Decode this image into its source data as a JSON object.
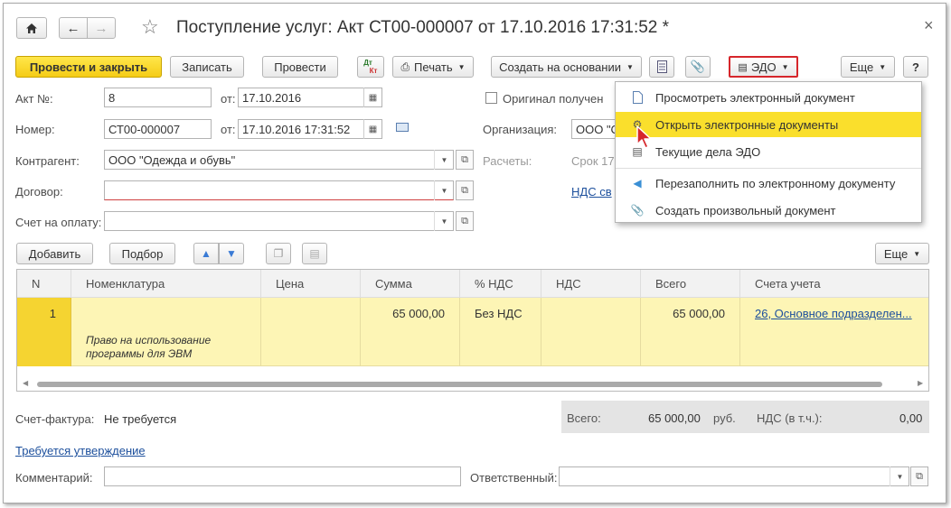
{
  "window": {
    "title": "Поступление услуг: Акт СТ00-000007 от 17.10.2016 17:31:52 *",
    "close_glyph": "×"
  },
  "toolbar": {
    "post_close": "Провести и закрыть",
    "save": "Записать",
    "post": "Провести",
    "dtkt_top": "Дт",
    "dtkt_bottom": "Кт",
    "print": "Печать",
    "create_based": "Создать на основании",
    "edo": "ЭДО",
    "more": "Еще",
    "help": "?"
  },
  "form": {
    "act_no_label": "Акт №:",
    "act_no_value": "8",
    "from_label": "от:",
    "act_date": "17.10.2016",
    "original_label": "Оригинал получен",
    "number_label": "Номер:",
    "number_value": "СТ00-000007",
    "number_date": "17.10.2016 17:31:52",
    "org_label": "Организация:",
    "org_value": "ООО \"С",
    "contractor_label": "Контрагент:",
    "contractor_value": "ООО \"Одежда и обувь\"",
    "settlements_label": "Расчеты:",
    "settlements_value": "Срок 17",
    "contract_label": "Договор:",
    "contract_value": "",
    "vat_link": "НДС св",
    "invoice_label": "Счет на оплату:",
    "invoice_value": ""
  },
  "table_toolbar": {
    "add": "Добавить",
    "select": "Подбор",
    "more": "Еще"
  },
  "table": {
    "columns": [
      "N",
      "Номенклатура",
      "Цена",
      "Сумма",
      "% НДС",
      "НДС",
      "Всего",
      "Счета учета"
    ],
    "rows": [
      {
        "n": "1",
        "nomenclature": "",
        "content": "Право на использование программы для ЭВМ",
        "price": "",
        "sum": "65 000,00",
        "vat_rate": "Без НДС",
        "vat": "",
        "total": "65 000,00",
        "accounts": "26, Основное подразделен..."
      }
    ]
  },
  "footer": {
    "invoice_label": "Счет-фактура:",
    "invoice_value": "Не требуется",
    "approval_link": "Требуется утверждение",
    "total_label": "Всего:",
    "total_value": "65 000,00",
    "currency": "руб.",
    "vat_label": "НДС (в т.ч.):",
    "vat_value": "0,00",
    "comment_label": "Комментарий:",
    "responsible_label": "Ответственный:"
  },
  "edo_menu": {
    "items": [
      {
        "label": "Просмотреть электронный документ",
        "icon": "document-icon"
      },
      {
        "label": "Открыть электронные документы",
        "icon": "edo-documents-icon"
      },
      {
        "label": "Текущие дела ЭДО",
        "icon": "edo-tasks-icon"
      },
      {
        "label": "Перезаполнить по электронному документу",
        "icon": "refill-arrow-icon"
      },
      {
        "label": "Создать произвольный документ",
        "icon": "paperclip-icon"
      }
    ]
  },
  "colors": {
    "accent_yellow": "#fadc3c",
    "row_highlight": "#fdf5b5",
    "menu_highlight": "#fadf2c",
    "link": "#1c4f9c",
    "edo_border": "#d6262b"
  }
}
